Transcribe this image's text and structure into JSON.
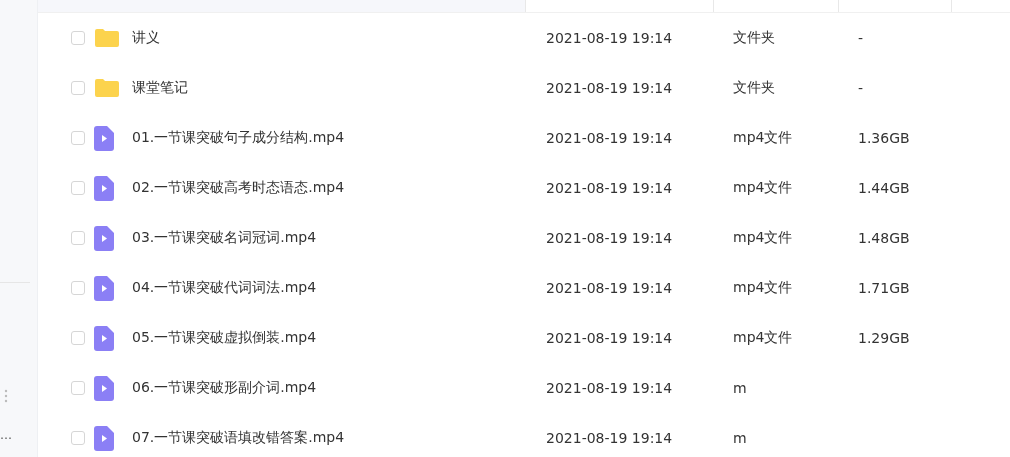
{
  "sidebar": {
    "more_text": "…"
  },
  "files": [
    {
      "kind": "folder",
      "checked": false,
      "name": "讲义",
      "modified": "2021-08-19 19:14",
      "type": "文件夹",
      "size": "-"
    },
    {
      "kind": "folder",
      "checked": false,
      "name": "课堂笔记",
      "modified": "2021-08-19 19:14",
      "type": "文件夹",
      "size": "-"
    },
    {
      "kind": "video",
      "checked": false,
      "name": "01.一节课突破句子成分结构.mp4",
      "modified": "2021-08-19 19:14",
      "type": "mp4文件",
      "size": "1.36GB"
    },
    {
      "kind": "video",
      "checked": false,
      "name": "02.一节课突破高考时态语态.mp4",
      "modified": "2021-08-19 19:14",
      "type": "mp4文件",
      "size": "1.44GB"
    },
    {
      "kind": "video",
      "checked": false,
      "name": "03.一节课突破名词冠词.mp4",
      "modified": "2021-08-19 19:14",
      "type": "mp4文件",
      "size": "1.48GB"
    },
    {
      "kind": "video",
      "checked": false,
      "name": "04.一节课突破代词词法.mp4",
      "modified": "2021-08-19 19:14",
      "type": "mp4文件",
      "size": "1.71GB"
    },
    {
      "kind": "video",
      "checked": false,
      "name": "05.一节课突破虚拟倒装.mp4",
      "modified": "2021-08-19 19:14",
      "type": "mp4文件",
      "size": "1.29GB"
    },
    {
      "kind": "video",
      "checked": false,
      "name": "06.一节课突破形副介词.mp4",
      "modified": "2021-08-19 19:14",
      "type": "m"
    },
    {
      "kind": "video",
      "checked": false,
      "name": "07.一节课突破语填改错答案.mp4",
      "modified": "2021-08-19 19:14",
      "type": "m"
    }
  ]
}
